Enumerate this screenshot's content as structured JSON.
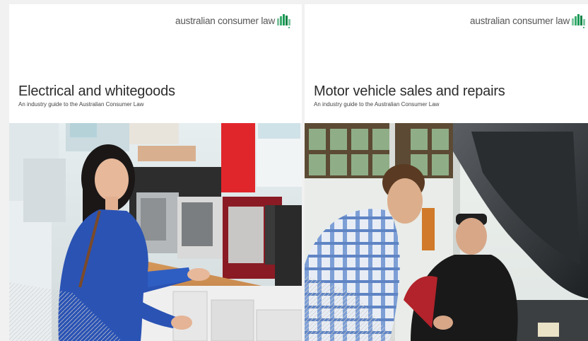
{
  "brand": {
    "text": "australian consumer law",
    "icon": "acl-logo-icon",
    "accent": "#1a9b57"
  },
  "covers": [
    {
      "title": "Electrical and whitegoods",
      "subtitle": "An industry guide to the Australian Consumer Law",
      "photo": "woman-shopping-microwaves-photo"
    },
    {
      "title": "Motor vehicle sales and repairs",
      "subtitle": "An industry guide to the Australian Consumer Law",
      "photo": "mechanics-car-bonnet-photo"
    }
  ]
}
